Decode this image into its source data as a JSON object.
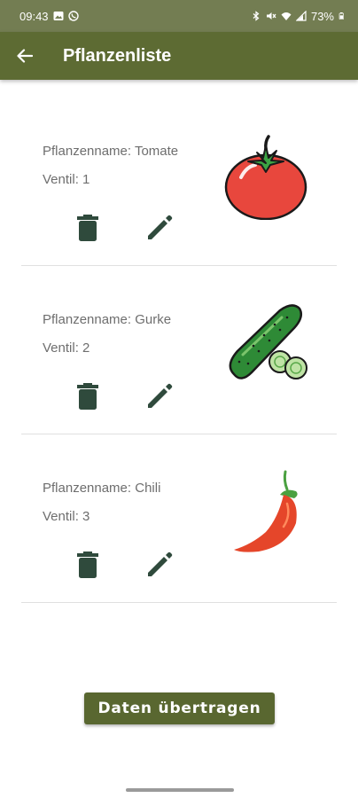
{
  "status_bar": {
    "time": "09:43",
    "battery": "73%",
    "left_icons": [
      "image-icon",
      "whatsapp-icon"
    ],
    "right_icons": [
      "bluetooth-icon",
      "mute-icon",
      "wifi-icon",
      "signal-icon",
      "battery-icon"
    ]
  },
  "app_bar": {
    "title": "Pflanzenliste",
    "back_icon": "arrow-left-icon",
    "color": "#5d6b33"
  },
  "plants": [
    {
      "name": "Pflanzenname: Tomate",
      "valve": "Ventil: 1",
      "image": "tomato-illustration"
    },
    {
      "name": "Pflanzenname: Gurke",
      "valve": "Ventil: 2",
      "image": "cucumber-illustration"
    },
    {
      "name": "Pflanzenname: Chili",
      "valve": "Ventil: 3",
      "image": "chili-illustration"
    }
  ],
  "actions": {
    "delete_icon": "trash-icon",
    "edit_icon": "pencil-icon",
    "icon_color": "#2f4a3c"
  },
  "submit_button": {
    "label": "Daten übertragen",
    "color": "#596730"
  }
}
